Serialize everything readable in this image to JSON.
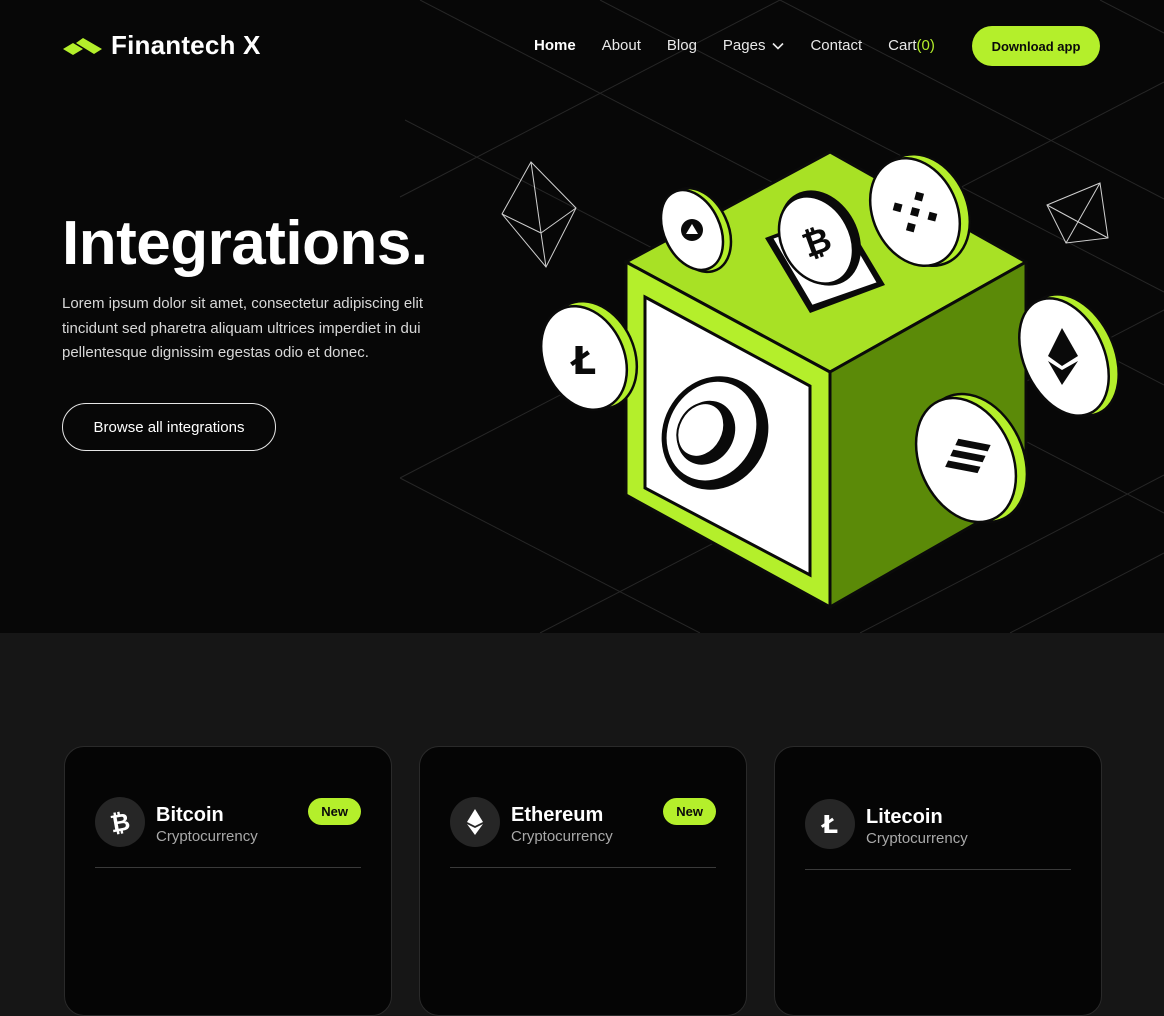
{
  "brand": {
    "name": "Finantech X",
    "accent": "#b4ef2b"
  },
  "nav": {
    "links": [
      {
        "label": "Home",
        "active": true
      },
      {
        "label": "About"
      },
      {
        "label": "Blog"
      },
      {
        "label": "Pages",
        "has_dropdown": true
      },
      {
        "label": "Contact"
      }
    ],
    "cart_label": "Cart",
    "cart_count": "(0)",
    "cta_label": "Download app"
  },
  "hero": {
    "title": "Integrations.",
    "description": "Lorem ipsum dolor sit amet, consectetur adipiscing elit tincidunt sed pharetra aliquam ultrices imperdiet in dui pellentesque dignissim egestas odio et donec.",
    "button_label": "Browse all integrations"
  },
  "illustration": {
    "coin_icons": [
      "tether-icon",
      "bitcoin-icon",
      "binance-icon",
      "litecoin-icon",
      "ethereum-icon",
      "solana-icon"
    ]
  },
  "cards": [
    {
      "name": "Bitcoin",
      "category": "Cryptocurrency",
      "badge": "New",
      "icon": "bitcoin-icon"
    },
    {
      "name": "Ethereum",
      "category": "Cryptocurrency",
      "badge": "New",
      "icon": "ethereum-icon"
    },
    {
      "name": "Litecoin",
      "category": "Cryptocurrency",
      "badge": "",
      "icon": "litecoin-icon"
    }
  ]
}
